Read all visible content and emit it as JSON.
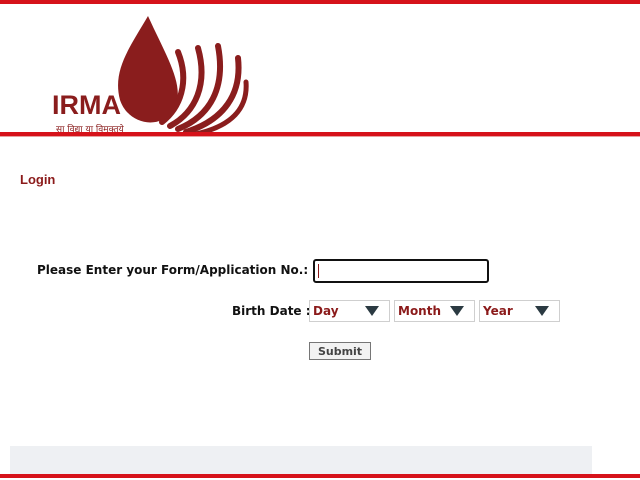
{
  "logo": {
    "text": "IRMA",
    "tagline": "सा विद्या या विमुक्तये",
    "color": "#8a1d1d"
  },
  "page": {
    "title": "Login"
  },
  "form": {
    "application_label": "Please Enter your Form/Application No.:",
    "application_value": "",
    "birth_label": "Birth Date :",
    "day_selected": "Day",
    "month_selected": "Month",
    "year_selected": "Year",
    "submit_label": "Submit"
  },
  "colors": {
    "accent": "#d6121a",
    "label_red": "#8b1a1a"
  }
}
